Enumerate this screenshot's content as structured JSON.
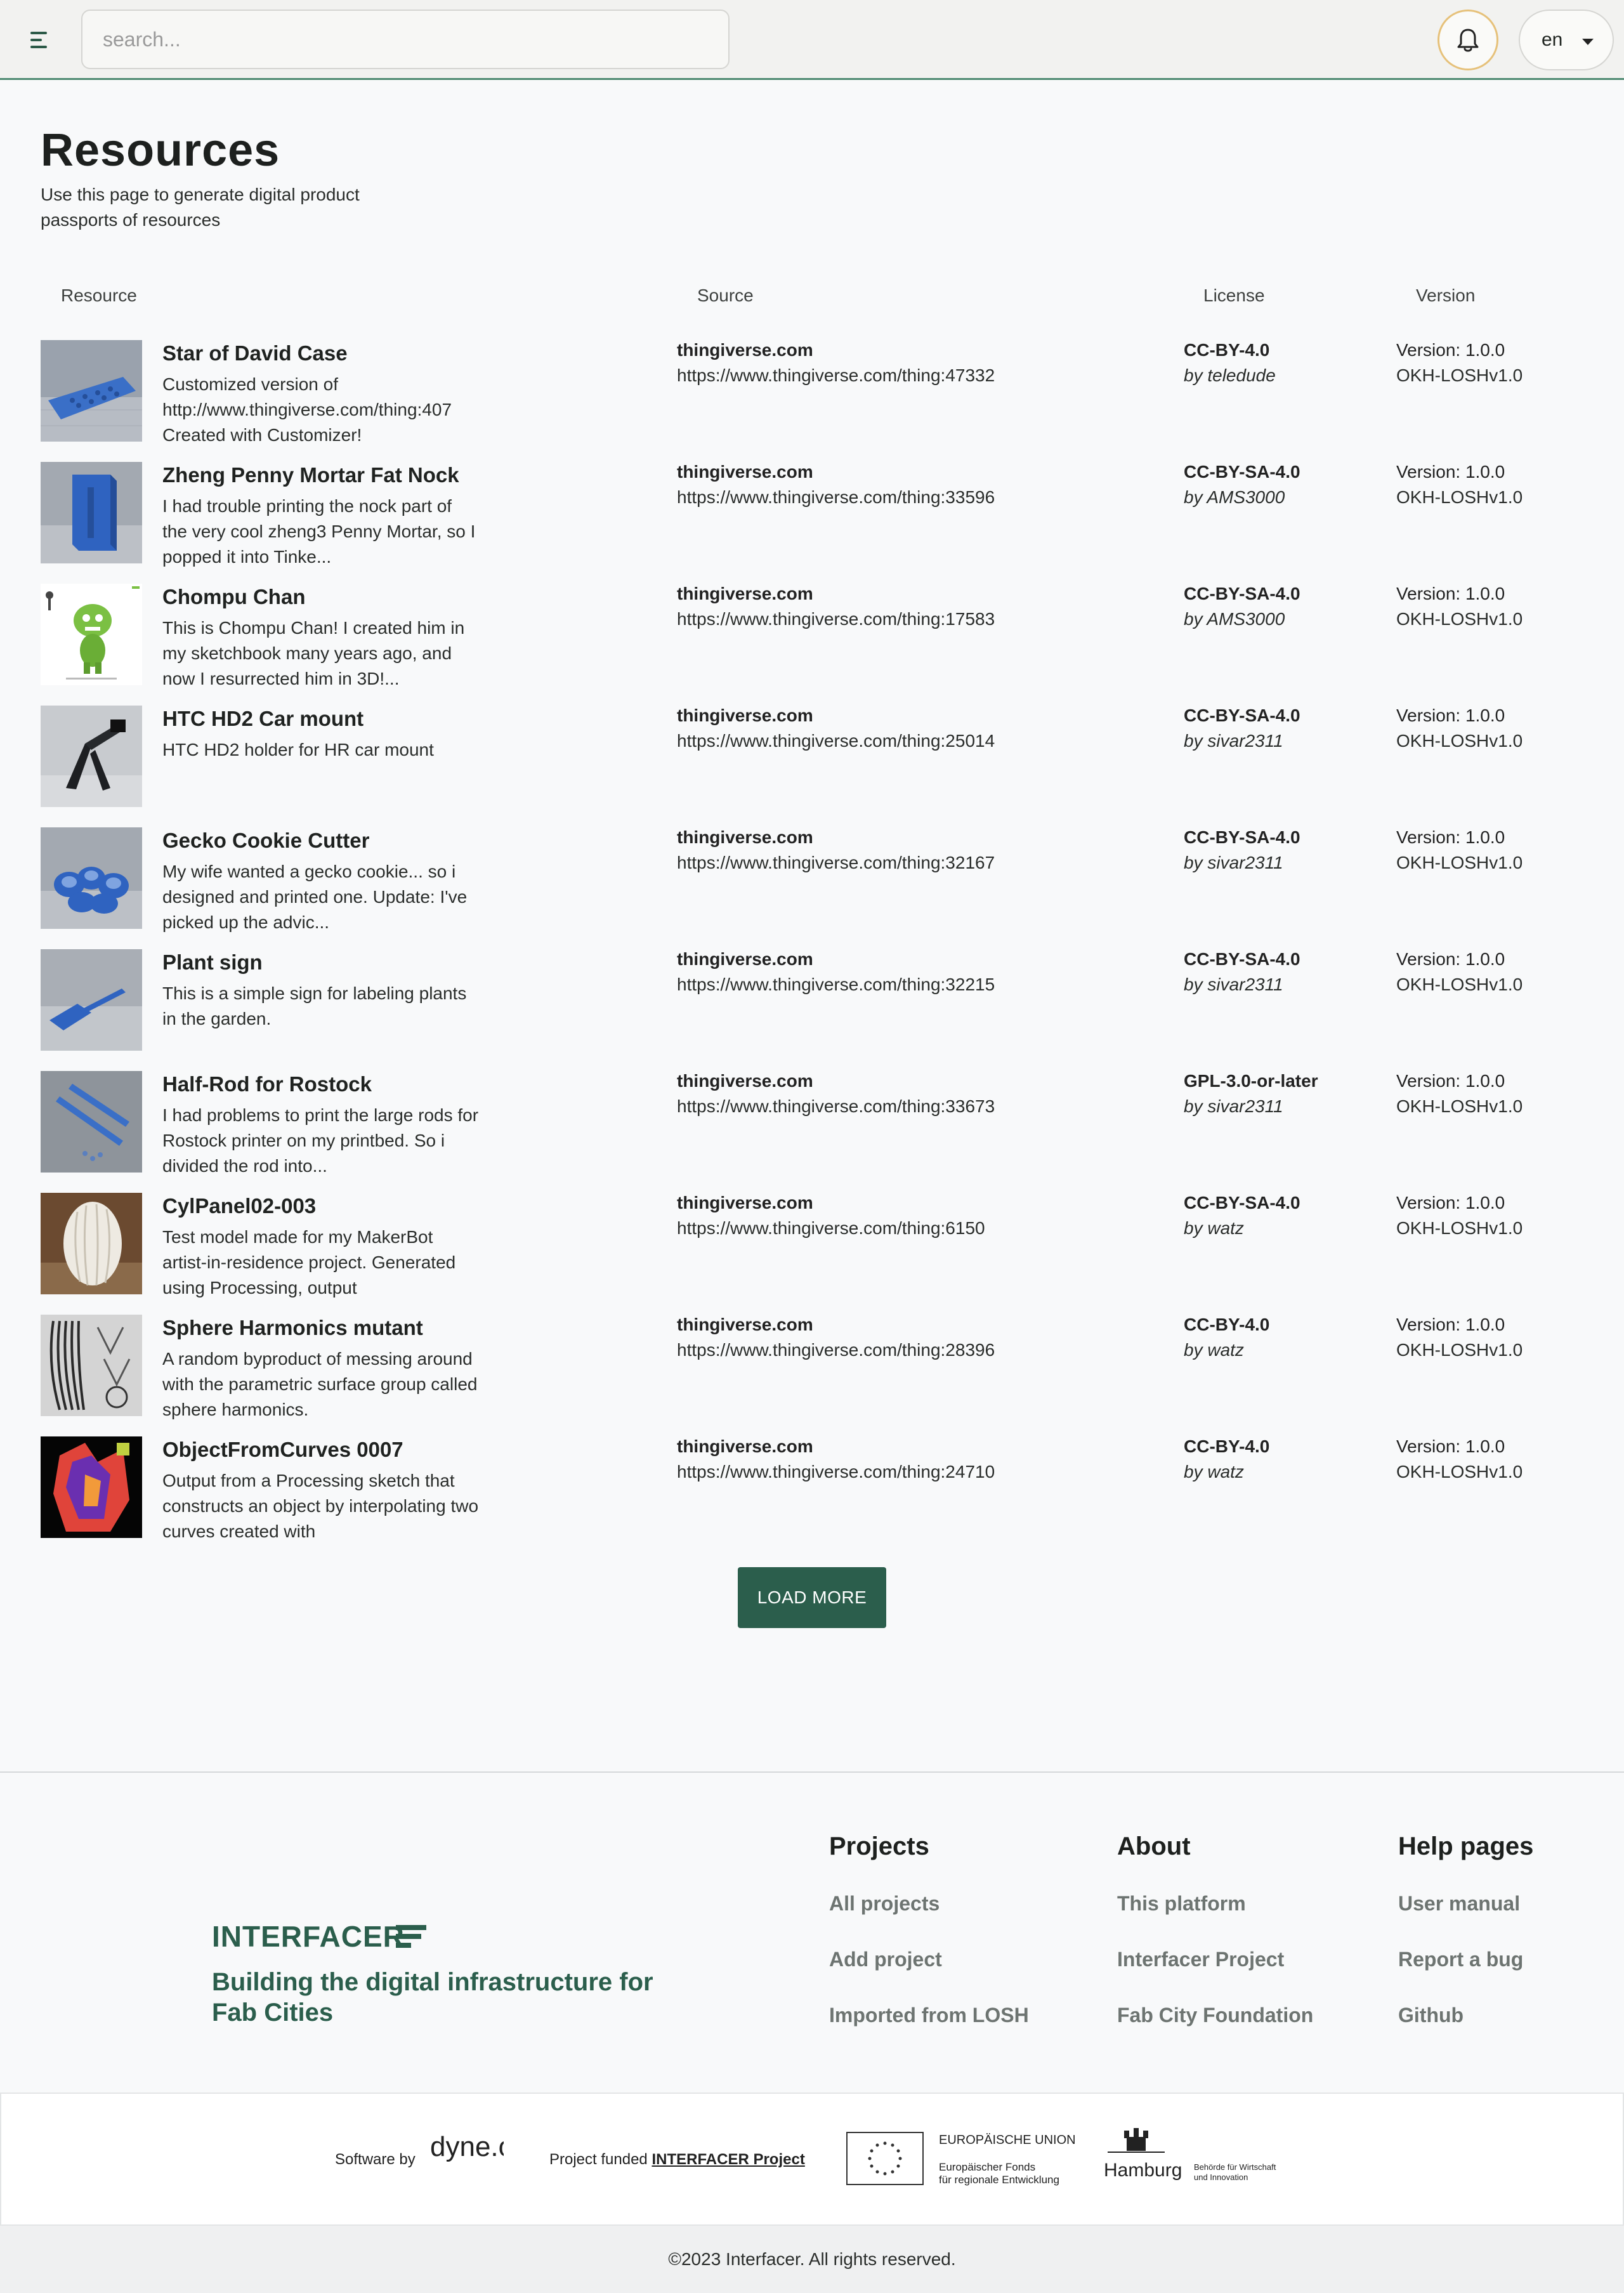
{
  "header": {
    "search_placeholder": "search...",
    "language": "en"
  },
  "page": {
    "title": "Resources",
    "subtitle": "Use this page to generate digital product passports of resources"
  },
  "table": {
    "columns": [
      "Resource",
      "Source",
      "License",
      "Version"
    ],
    "rows": [
      {
        "title": "Star of David Case",
        "desc": "Customized version of http://www.thingiverse.com/thing:407 Created with Customizer!",
        "domain": "thingiverse.com",
        "url": "https://www.thingiverse.com/thing:47332",
        "license": "CC-BY-4.0",
        "by": "by teledude",
        "version": "Version: 1.0.0",
        "standard": "OKH-LOSHv1.0"
      },
      {
        "title": "Zheng Penny Mortar Fat Nock",
        "desc": "I had trouble printing the nock part of the very cool zheng3 Penny Mortar, so I popped it into Tinke...",
        "domain": "thingiverse.com",
        "url": "https://www.thingiverse.com/thing:33596",
        "license": "CC-BY-SA-4.0",
        "by": "by AMS3000",
        "version": "Version: 1.0.0",
        "standard": "OKH-LOSHv1.0"
      },
      {
        "title": "Chompu Chan",
        "desc": "This is Chompu Chan! I created him in my sketchbook many years ago, and now I resurrected him in 3D!...",
        "domain": "thingiverse.com",
        "url": "https://www.thingiverse.com/thing:17583",
        "license": "CC-BY-SA-4.0",
        "by": "by AMS3000",
        "version": "Version: 1.0.0",
        "standard": "OKH-LOSHv1.0"
      },
      {
        "title": "HTC HD2 Car mount",
        "desc": "HTC HD2 holder for HR car mount",
        "domain": "thingiverse.com",
        "url": "https://www.thingiverse.com/thing:25014",
        "license": "CC-BY-SA-4.0",
        "by": "by sivar2311",
        "version": "Version: 1.0.0",
        "standard": "OKH-LOSHv1.0"
      },
      {
        "title": "Gecko Cookie Cutter",
        "desc": "My wife wanted a gecko cookie... so i designed and printed one. Update: I've picked up the advic...",
        "domain": "thingiverse.com",
        "url": "https://www.thingiverse.com/thing:32167",
        "license": "CC-BY-SA-4.0",
        "by": "by sivar2311",
        "version": "Version: 1.0.0",
        "standard": "OKH-LOSHv1.0"
      },
      {
        "title": "Plant sign",
        "desc": "This is a simple sign for labeling plants in the garden.",
        "domain": "thingiverse.com",
        "url": "https://www.thingiverse.com/thing:32215",
        "license": "CC-BY-SA-4.0",
        "by": "by sivar2311",
        "version": "Version: 1.0.0",
        "standard": "OKH-LOSHv1.0"
      },
      {
        "title": "Half-Rod for Rostock",
        "desc": "I had problems to print the large rods for Rostock printer on my printbed. So i divided the rod into...",
        "domain": "thingiverse.com",
        "url": "https://www.thingiverse.com/thing:33673",
        "license": "GPL-3.0-or-later",
        "by": "by sivar2311",
        "version": "Version: 1.0.0",
        "standard": "OKH-LOSHv1.0"
      },
      {
        "title": "CylPanel02-003",
        "desc": "Test model made for my MakerBot artist-in-residence project. Generated using Processing, output",
        "domain": "thingiverse.com",
        "url": "https://www.thingiverse.com/thing:6150",
        "license": "CC-BY-SA-4.0",
        "by": "by watz",
        "version": "Version: 1.0.0",
        "standard": "OKH-LOSHv1.0"
      },
      {
        "title": "Sphere Harmonics mutant",
        "desc": "A random byproduct of messing around with the parametric surface group called sphere harmonics.",
        "domain": "thingiverse.com",
        "url": "https://www.thingiverse.com/thing:28396",
        "license": "CC-BY-4.0",
        "by": "by watz",
        "version": "Version: 1.0.0",
        "standard": "OKH-LOSHv1.0"
      },
      {
        "title": "ObjectFromCurves 0007",
        "desc": "Output from a Processing sketch that constructs an object by interpolating two curves created with",
        "domain": "thingiverse.com",
        "url": "https://www.thingiverse.com/thing:24710",
        "license": "CC-BY-4.0",
        "by": "by watz",
        "version": "Version: 1.0.0",
        "standard": "OKH-LOSHv1.0"
      }
    ],
    "load_more": "LOAD MORE"
  },
  "footer": {
    "logo_text": "INTERFACER",
    "tagline": "Building the digital infrastructure for Fab Cities",
    "projects": {
      "title": "Projects",
      "links": [
        "All projects",
        "Add project",
        "Imported from LOSH"
      ]
    },
    "about": {
      "title": "About",
      "links": [
        "This platform",
        "Interfacer Project",
        "Fab City Foundation"
      ]
    },
    "help": {
      "title": "Help pages",
      "links": [
        "User manual",
        "Report a bug",
        "Github"
      ]
    },
    "partners": {
      "software_by": "Software by",
      "dyne_logo": "dyne.org",
      "funded_prefix": "Project funded",
      "funded_link": "INTERFACER Project",
      "eu_title": "EUROPÄISCHE UNION",
      "eu_line1": "Europäischer Fonds",
      "eu_line2": "für regionale Entwicklung",
      "hamburg": "Hamburg",
      "hamburg_line1": "Behörde für Wirtschaft",
      "hamburg_line2": "und Innovation"
    },
    "copyright": "©2023 Interfacer. All rights reserved."
  },
  "colors": {
    "accent": "#2b5e4c",
    "header_border": "#4f8a72",
    "bell_ring": "#e6c17a",
    "thumb_blue": "#3a6fc7"
  }
}
